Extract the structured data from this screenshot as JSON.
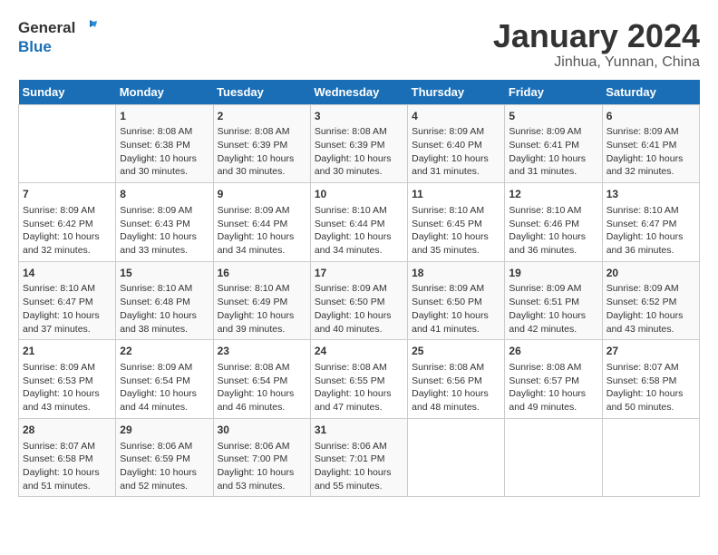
{
  "header": {
    "logo_line1": "General",
    "logo_line2": "Blue",
    "title": "January 2024",
    "subtitle": "Jinhua, Yunnan, China"
  },
  "days_of_week": [
    "Sunday",
    "Monday",
    "Tuesday",
    "Wednesday",
    "Thursday",
    "Friday",
    "Saturday"
  ],
  "weeks": [
    [
      {
        "day": "",
        "info": ""
      },
      {
        "day": "1",
        "info": "Sunrise: 8:08 AM\nSunset: 6:38 PM\nDaylight: 10 hours\nand 30 minutes."
      },
      {
        "day": "2",
        "info": "Sunrise: 8:08 AM\nSunset: 6:39 PM\nDaylight: 10 hours\nand 30 minutes."
      },
      {
        "day": "3",
        "info": "Sunrise: 8:08 AM\nSunset: 6:39 PM\nDaylight: 10 hours\nand 30 minutes."
      },
      {
        "day": "4",
        "info": "Sunrise: 8:09 AM\nSunset: 6:40 PM\nDaylight: 10 hours\nand 31 minutes."
      },
      {
        "day": "5",
        "info": "Sunrise: 8:09 AM\nSunset: 6:41 PM\nDaylight: 10 hours\nand 31 minutes."
      },
      {
        "day": "6",
        "info": "Sunrise: 8:09 AM\nSunset: 6:41 PM\nDaylight: 10 hours\nand 32 minutes."
      }
    ],
    [
      {
        "day": "7",
        "info": "Sunrise: 8:09 AM\nSunset: 6:42 PM\nDaylight: 10 hours\nand 32 minutes."
      },
      {
        "day": "8",
        "info": "Sunrise: 8:09 AM\nSunset: 6:43 PM\nDaylight: 10 hours\nand 33 minutes."
      },
      {
        "day": "9",
        "info": "Sunrise: 8:09 AM\nSunset: 6:44 PM\nDaylight: 10 hours\nand 34 minutes."
      },
      {
        "day": "10",
        "info": "Sunrise: 8:10 AM\nSunset: 6:44 PM\nDaylight: 10 hours\nand 34 minutes."
      },
      {
        "day": "11",
        "info": "Sunrise: 8:10 AM\nSunset: 6:45 PM\nDaylight: 10 hours\nand 35 minutes."
      },
      {
        "day": "12",
        "info": "Sunrise: 8:10 AM\nSunset: 6:46 PM\nDaylight: 10 hours\nand 36 minutes."
      },
      {
        "day": "13",
        "info": "Sunrise: 8:10 AM\nSunset: 6:47 PM\nDaylight: 10 hours\nand 36 minutes."
      }
    ],
    [
      {
        "day": "14",
        "info": "Sunrise: 8:10 AM\nSunset: 6:47 PM\nDaylight: 10 hours\nand 37 minutes."
      },
      {
        "day": "15",
        "info": "Sunrise: 8:10 AM\nSunset: 6:48 PM\nDaylight: 10 hours\nand 38 minutes."
      },
      {
        "day": "16",
        "info": "Sunrise: 8:10 AM\nSunset: 6:49 PM\nDaylight: 10 hours\nand 39 minutes."
      },
      {
        "day": "17",
        "info": "Sunrise: 8:09 AM\nSunset: 6:50 PM\nDaylight: 10 hours\nand 40 minutes."
      },
      {
        "day": "18",
        "info": "Sunrise: 8:09 AM\nSunset: 6:50 PM\nDaylight: 10 hours\nand 41 minutes."
      },
      {
        "day": "19",
        "info": "Sunrise: 8:09 AM\nSunset: 6:51 PM\nDaylight: 10 hours\nand 42 minutes."
      },
      {
        "day": "20",
        "info": "Sunrise: 8:09 AM\nSunset: 6:52 PM\nDaylight: 10 hours\nand 43 minutes."
      }
    ],
    [
      {
        "day": "21",
        "info": "Sunrise: 8:09 AM\nSunset: 6:53 PM\nDaylight: 10 hours\nand 43 minutes."
      },
      {
        "day": "22",
        "info": "Sunrise: 8:09 AM\nSunset: 6:54 PM\nDaylight: 10 hours\nand 44 minutes."
      },
      {
        "day": "23",
        "info": "Sunrise: 8:08 AM\nSunset: 6:54 PM\nDaylight: 10 hours\nand 46 minutes."
      },
      {
        "day": "24",
        "info": "Sunrise: 8:08 AM\nSunset: 6:55 PM\nDaylight: 10 hours\nand 47 minutes."
      },
      {
        "day": "25",
        "info": "Sunrise: 8:08 AM\nSunset: 6:56 PM\nDaylight: 10 hours\nand 48 minutes."
      },
      {
        "day": "26",
        "info": "Sunrise: 8:08 AM\nSunset: 6:57 PM\nDaylight: 10 hours\nand 49 minutes."
      },
      {
        "day": "27",
        "info": "Sunrise: 8:07 AM\nSunset: 6:58 PM\nDaylight: 10 hours\nand 50 minutes."
      }
    ],
    [
      {
        "day": "28",
        "info": "Sunrise: 8:07 AM\nSunset: 6:58 PM\nDaylight: 10 hours\nand 51 minutes."
      },
      {
        "day": "29",
        "info": "Sunrise: 8:06 AM\nSunset: 6:59 PM\nDaylight: 10 hours\nand 52 minutes."
      },
      {
        "day": "30",
        "info": "Sunrise: 8:06 AM\nSunset: 7:00 PM\nDaylight: 10 hours\nand 53 minutes."
      },
      {
        "day": "31",
        "info": "Sunrise: 8:06 AM\nSunset: 7:01 PM\nDaylight: 10 hours\nand 55 minutes."
      },
      {
        "day": "",
        "info": ""
      },
      {
        "day": "",
        "info": ""
      },
      {
        "day": "",
        "info": ""
      }
    ]
  ]
}
